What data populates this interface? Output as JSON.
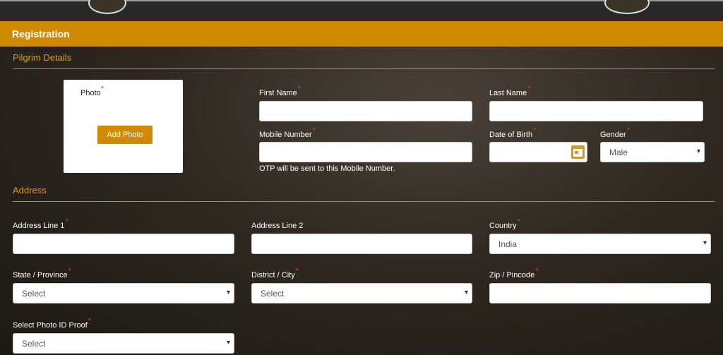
{
  "header": {
    "title": "Registration"
  },
  "pilgrim": {
    "title": "Pilgrim Details",
    "photo_label": "Photo",
    "add_photo": "Add Photo",
    "first_name": "First Name",
    "last_name": "Last Name",
    "mobile": "Mobile Number",
    "dob": "Date of Birth",
    "gender": "Gender",
    "gender_value": "Male",
    "otp_note": "OTP will be sent to this Mobile Number."
  },
  "address": {
    "title": "Address",
    "line1": "Address Line 1",
    "line2": "Address Line 2",
    "country": "Country",
    "country_value": "India",
    "state": "State / Province",
    "state_value": "Select",
    "district": "District / City",
    "district_value": "Select",
    "zip": "Zip / Pincode",
    "photo_id": "Select Photo ID Proof",
    "photo_id_value": "Select"
  },
  "required_mark": "*",
  "colors": {
    "accent": "#d08a00",
    "header": "#2a2826"
  }
}
